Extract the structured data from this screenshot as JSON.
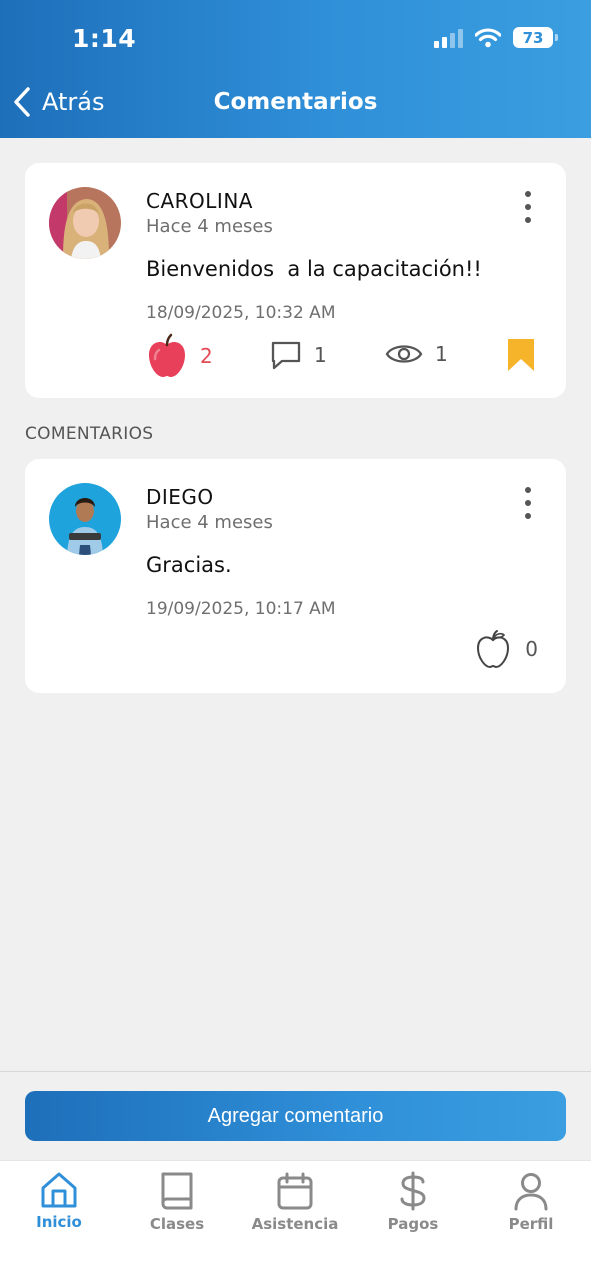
{
  "status": {
    "time": "1:14",
    "battery": "73"
  },
  "nav": {
    "back_label": "Atrás",
    "title": "Comentarios"
  },
  "post": {
    "author": "CAROLINA",
    "ago": "Hace 4 meses",
    "text": "Bienvenidos  a la capacitación!!",
    "date": "18/09/2025, 10:32 AM",
    "likes": "2",
    "comments": "1",
    "views": "1",
    "like_icon": "apple-filled-icon",
    "bookmark_icon": "bookmark-icon",
    "like_color": "#e8405a",
    "bookmark_color": "#f6b42a"
  },
  "section_label": "COMENTARIOS",
  "comments": [
    {
      "author": "DIEGO",
      "ago": "Hace 4 meses",
      "text": "Gracias.",
      "date": "19/09/2025, 10:17 AM",
      "likes": "0",
      "like_icon": "apple-outline-icon"
    }
  ],
  "actions": {
    "add_comment": "Agregar comentario"
  },
  "tabs": [
    {
      "label": "Inicio",
      "icon": "home-icon",
      "active": true
    },
    {
      "label": "Clases",
      "icon": "book-icon",
      "active": false
    },
    {
      "label": "Asistencia",
      "icon": "calendar-icon",
      "active": false
    },
    {
      "label": "Pagos",
      "icon": "dollar-icon",
      "active": false
    },
    {
      "label": "Perfil",
      "icon": "user-icon",
      "active": false
    }
  ],
  "colors": {
    "primary": "#2f8fd8",
    "primary_dark": "#1e6fba",
    "background": "#f0f0f0"
  }
}
